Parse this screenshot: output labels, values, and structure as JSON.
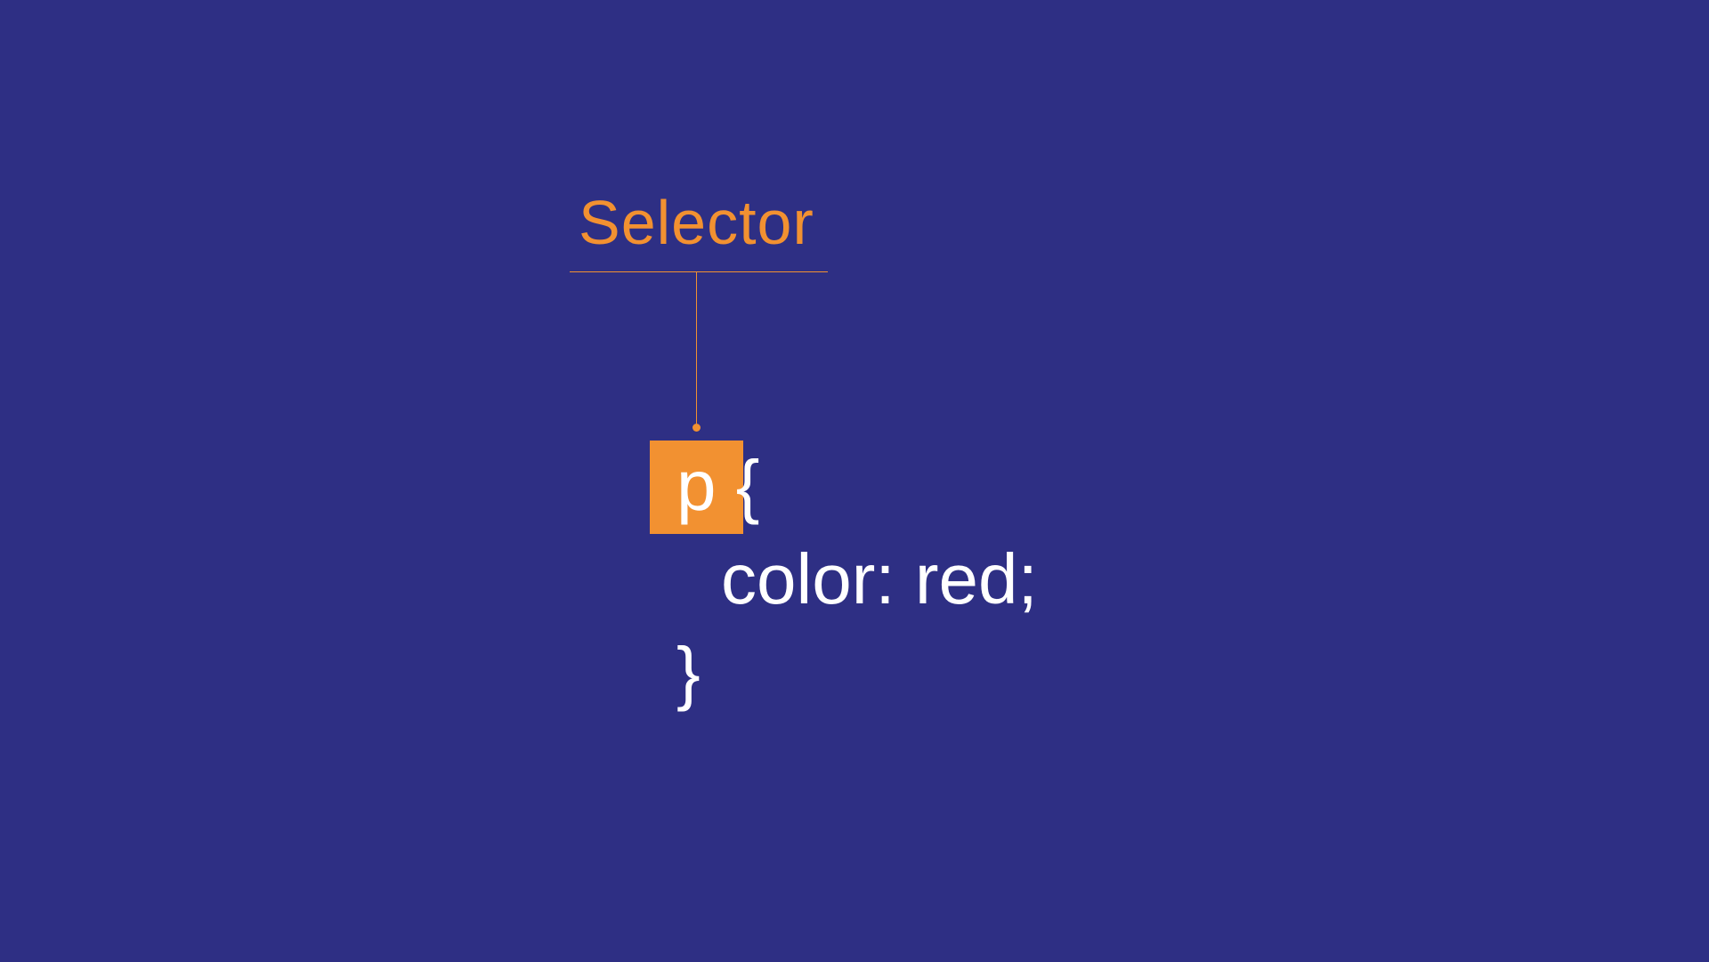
{
  "label": {
    "selector": "Selector"
  },
  "code": {
    "selector_char": "p",
    "open_brace": "{",
    "declaration": "color: red;",
    "close_brace": "}"
  },
  "colors": {
    "background": "#2e2f84",
    "accent": "#f29131",
    "text": "#ffffff"
  }
}
